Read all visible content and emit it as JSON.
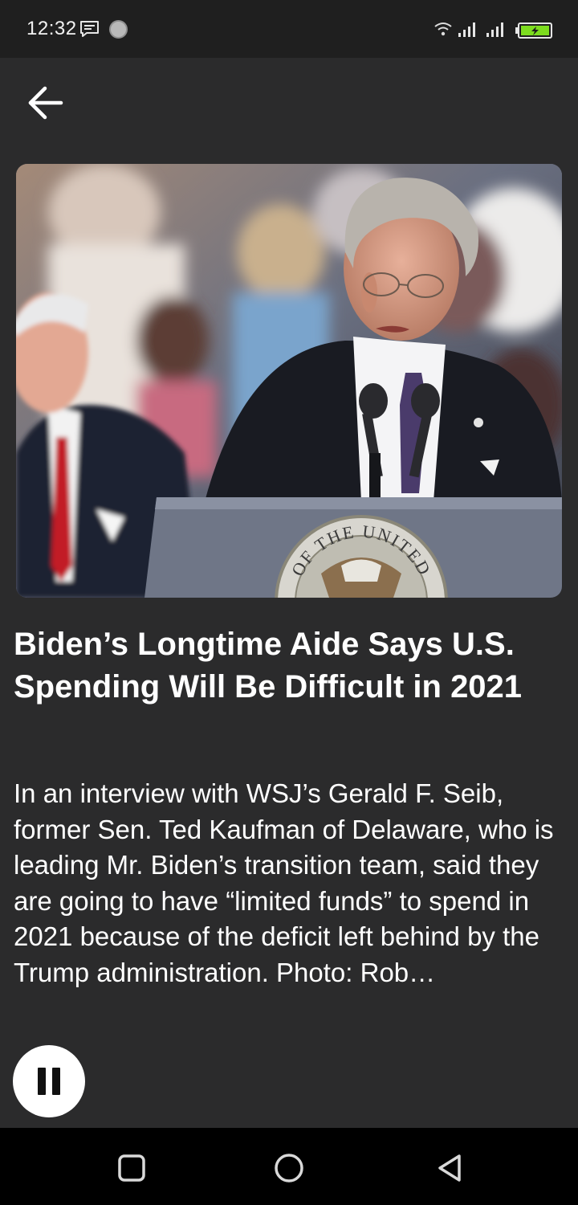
{
  "status_bar": {
    "time": "12:32",
    "icons": [
      "message-icon",
      "circle-status-icon",
      "wifi-icon",
      "signal-icon",
      "signal-icon",
      "battery-charging-icon"
    ]
  },
  "top_bar": {
    "back_icon": "arrow-left-icon"
  },
  "article": {
    "image_alt": "Ted Kaufman speaking at a podium with the vice presidential seal, Joe Biden in the background",
    "seal_text": "OF THE UNITED",
    "headline": "Biden’s Longtime Aide Says U.S. Spending Will Be Difficult in 2021",
    "summary": "In an interview with WSJ’s Gerald F. Seib, former Sen. Ted Kaufman of Delaware, who is leading Mr. Biden’s transition team, said they are going to have “limited funds” to spend in 2021 because of the deficit left behind by the Trump administration. Photo: Rob…"
  },
  "player": {
    "state_icon": "pause-icon"
  },
  "nav_bar": {
    "items": [
      "recents-square-icon",
      "home-circle-icon",
      "back-triangle-icon"
    ]
  },
  "colors": {
    "background": "#2b2b2c",
    "status_bar": "#1f1f1f",
    "text": "#ffffff",
    "battery_charge": "#7ddc1f"
  }
}
